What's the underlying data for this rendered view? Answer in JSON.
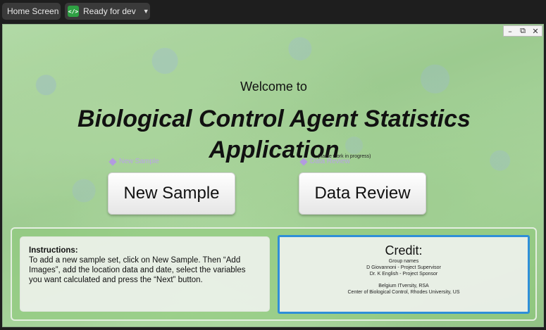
{
  "topbar": {
    "home_label": "Home Screen",
    "status_label": "Ready for dev",
    "status_icon": "code-icon"
  },
  "window_controls": {
    "minimize": "minimize-icon",
    "maximize": "maximize-icon",
    "close": "close-icon"
  },
  "main": {
    "welcome": "Welcome to",
    "title": "Biological Control Agent Statistics Application",
    "wip_note": "(name work in progress)",
    "ghost_new": "New Sample",
    "ghost_data": "Data Review",
    "btn_new": "New Sample",
    "btn_data": "Data Review"
  },
  "instructions": {
    "heading": "Instructions:",
    "body": "To add a new sample set, click on New Sample. Then “Add Images”, add the location data and date, select the variables you want calculated and press the “Next” button."
  },
  "credit": {
    "title": "Credit:",
    "group": "Group names",
    "line1": "D Giovannoni - Project Supervisor",
    "line2": "Dr. K English - Project Sponsor",
    "line3": "Belgium ITversity, RSA",
    "line4": "Center of Biological Control, Rhodes University, US"
  },
  "colors": {
    "accent": "#2f8fd8",
    "status_green": "#2ea043",
    "panel_green": "#8cc878"
  }
}
